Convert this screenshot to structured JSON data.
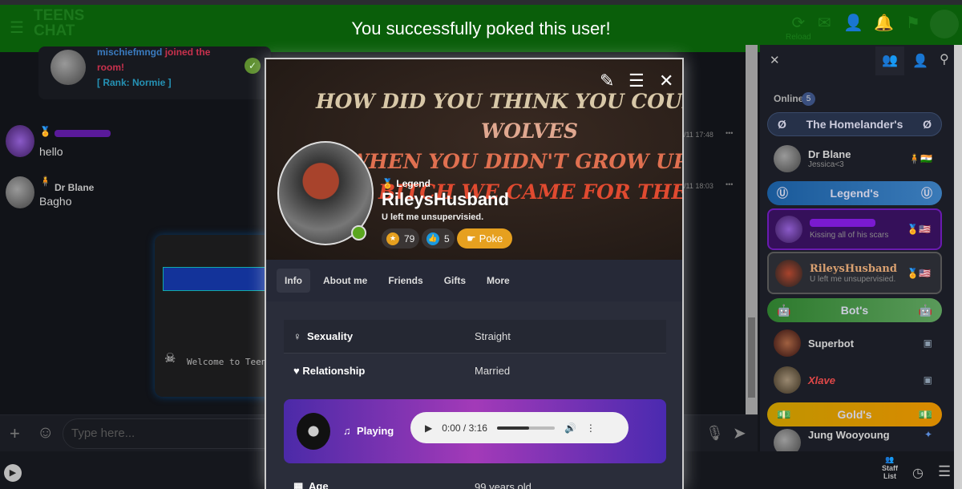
{
  "header": {
    "logo_line1": "TEENS",
    "logo_line2": "CHAT",
    "reload": "Reload",
    "toast": "You successfully poked this user!"
  },
  "chat": {
    "join": {
      "user": "mischiefmngd",
      "action": "joined the room!",
      "rank": "[ Rank: Normie ]"
    },
    "messages": [
      {
        "name": "",
        "text": "hello",
        "time": "/11 17:48"
      },
      {
        "name": "Dr Blane",
        "text": "Bagho",
        "time": "/11 18:03"
      }
    ],
    "welcome": "Welcome to Teen",
    "input_placeholder": "Type here..."
  },
  "panel": {
    "online_label": "Online",
    "online_count": "5",
    "groups": [
      "The Homelander's",
      "Legend's",
      "Bot's",
      "Gold's"
    ],
    "users": [
      {
        "name": "Dr Blane",
        "mood": "Jessica<3"
      },
      {
        "name": "",
        "mood": "Kissing all of his scars"
      },
      {
        "name": "RileysHusband",
        "mood": "U left me unsupervisied."
      },
      {
        "name": "Superbot",
        "mood": ""
      },
      {
        "name": "Xlave",
        "mood": ""
      },
      {
        "name": "Jung Wooyoung",
        "mood": ""
      }
    ],
    "staff_list": "Staff List"
  },
  "profile": {
    "banner": [
      "HOW DID YOU THINK YOU COULD RUN WITH",
      "WOLVES",
      "WHEN YOU DIDN'T GROW UP IN THE WOODS",
      "BITCH WE CAME FOR THE POUND"
    ],
    "rank": "Legend",
    "username": "RileysHusband",
    "mood": "U left me unsupervisied.",
    "stars": "79",
    "likes": "5",
    "poke": "Poke",
    "tabs": [
      "Info",
      "About me",
      "Friends",
      "Gifts",
      "More"
    ],
    "info": [
      {
        "label": "Sexuality",
        "value": "Straight"
      },
      {
        "label": "Relationship",
        "value": "Married"
      },
      {
        "label": "Age",
        "value": "99 years old"
      }
    ],
    "player": {
      "status": "Playing",
      "time": "0:00 / 3:16",
      "buffered": 0.55
    }
  },
  "colors": {
    "header": "#0a5e0a",
    "poke": "#e6a01f",
    "online": "#5aa61f"
  }
}
